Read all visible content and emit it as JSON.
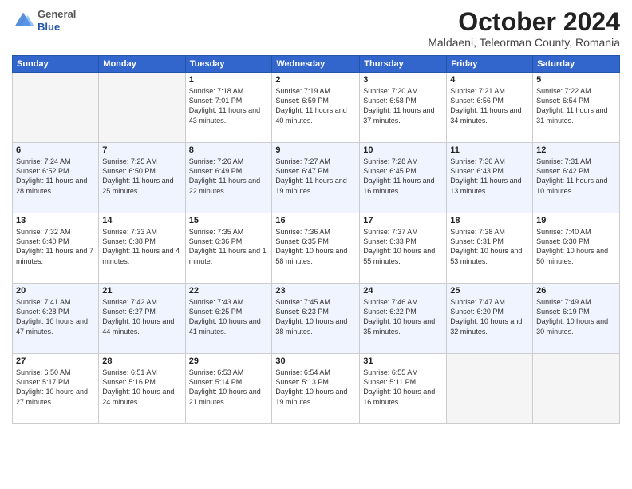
{
  "header": {
    "logo_general": "General",
    "logo_blue": "Blue",
    "month_title": "October 2024",
    "subtitle": "Maldaeni, Teleorman County, Romania"
  },
  "weekdays": [
    "Sunday",
    "Monday",
    "Tuesday",
    "Wednesday",
    "Thursday",
    "Friday",
    "Saturday"
  ],
  "weeks": [
    [
      {
        "day": "",
        "info": ""
      },
      {
        "day": "",
        "info": ""
      },
      {
        "day": "1",
        "info": "Sunrise: 7:18 AM\nSunset: 7:01 PM\nDaylight: 11 hours and 43 minutes."
      },
      {
        "day": "2",
        "info": "Sunrise: 7:19 AM\nSunset: 6:59 PM\nDaylight: 11 hours and 40 minutes."
      },
      {
        "day": "3",
        "info": "Sunrise: 7:20 AM\nSunset: 6:58 PM\nDaylight: 11 hours and 37 minutes."
      },
      {
        "day": "4",
        "info": "Sunrise: 7:21 AM\nSunset: 6:56 PM\nDaylight: 11 hours and 34 minutes."
      },
      {
        "day": "5",
        "info": "Sunrise: 7:22 AM\nSunset: 6:54 PM\nDaylight: 11 hours and 31 minutes."
      }
    ],
    [
      {
        "day": "6",
        "info": "Sunrise: 7:24 AM\nSunset: 6:52 PM\nDaylight: 11 hours and 28 minutes."
      },
      {
        "day": "7",
        "info": "Sunrise: 7:25 AM\nSunset: 6:50 PM\nDaylight: 11 hours and 25 minutes."
      },
      {
        "day": "8",
        "info": "Sunrise: 7:26 AM\nSunset: 6:49 PM\nDaylight: 11 hours and 22 minutes."
      },
      {
        "day": "9",
        "info": "Sunrise: 7:27 AM\nSunset: 6:47 PM\nDaylight: 11 hours and 19 minutes."
      },
      {
        "day": "10",
        "info": "Sunrise: 7:28 AM\nSunset: 6:45 PM\nDaylight: 11 hours and 16 minutes."
      },
      {
        "day": "11",
        "info": "Sunrise: 7:30 AM\nSunset: 6:43 PM\nDaylight: 11 hours and 13 minutes."
      },
      {
        "day": "12",
        "info": "Sunrise: 7:31 AM\nSunset: 6:42 PM\nDaylight: 11 hours and 10 minutes."
      }
    ],
    [
      {
        "day": "13",
        "info": "Sunrise: 7:32 AM\nSunset: 6:40 PM\nDaylight: 11 hours and 7 minutes."
      },
      {
        "day": "14",
        "info": "Sunrise: 7:33 AM\nSunset: 6:38 PM\nDaylight: 11 hours and 4 minutes."
      },
      {
        "day": "15",
        "info": "Sunrise: 7:35 AM\nSunset: 6:36 PM\nDaylight: 11 hours and 1 minute."
      },
      {
        "day": "16",
        "info": "Sunrise: 7:36 AM\nSunset: 6:35 PM\nDaylight: 10 hours and 58 minutes."
      },
      {
        "day": "17",
        "info": "Sunrise: 7:37 AM\nSunset: 6:33 PM\nDaylight: 10 hours and 55 minutes."
      },
      {
        "day": "18",
        "info": "Sunrise: 7:38 AM\nSunset: 6:31 PM\nDaylight: 10 hours and 53 minutes."
      },
      {
        "day": "19",
        "info": "Sunrise: 7:40 AM\nSunset: 6:30 PM\nDaylight: 10 hours and 50 minutes."
      }
    ],
    [
      {
        "day": "20",
        "info": "Sunrise: 7:41 AM\nSunset: 6:28 PM\nDaylight: 10 hours and 47 minutes."
      },
      {
        "day": "21",
        "info": "Sunrise: 7:42 AM\nSunset: 6:27 PM\nDaylight: 10 hours and 44 minutes."
      },
      {
        "day": "22",
        "info": "Sunrise: 7:43 AM\nSunset: 6:25 PM\nDaylight: 10 hours and 41 minutes."
      },
      {
        "day": "23",
        "info": "Sunrise: 7:45 AM\nSunset: 6:23 PM\nDaylight: 10 hours and 38 minutes."
      },
      {
        "day": "24",
        "info": "Sunrise: 7:46 AM\nSunset: 6:22 PM\nDaylight: 10 hours and 35 minutes."
      },
      {
        "day": "25",
        "info": "Sunrise: 7:47 AM\nSunset: 6:20 PM\nDaylight: 10 hours and 32 minutes."
      },
      {
        "day": "26",
        "info": "Sunrise: 7:49 AM\nSunset: 6:19 PM\nDaylight: 10 hours and 30 minutes."
      }
    ],
    [
      {
        "day": "27",
        "info": "Sunrise: 6:50 AM\nSunset: 5:17 PM\nDaylight: 10 hours and 27 minutes."
      },
      {
        "day": "28",
        "info": "Sunrise: 6:51 AM\nSunset: 5:16 PM\nDaylight: 10 hours and 24 minutes."
      },
      {
        "day": "29",
        "info": "Sunrise: 6:53 AM\nSunset: 5:14 PM\nDaylight: 10 hours and 21 minutes."
      },
      {
        "day": "30",
        "info": "Sunrise: 6:54 AM\nSunset: 5:13 PM\nDaylight: 10 hours and 19 minutes."
      },
      {
        "day": "31",
        "info": "Sunrise: 6:55 AM\nSunset: 5:11 PM\nDaylight: 10 hours and 16 minutes."
      },
      {
        "day": "",
        "info": ""
      },
      {
        "day": "",
        "info": ""
      }
    ]
  ]
}
